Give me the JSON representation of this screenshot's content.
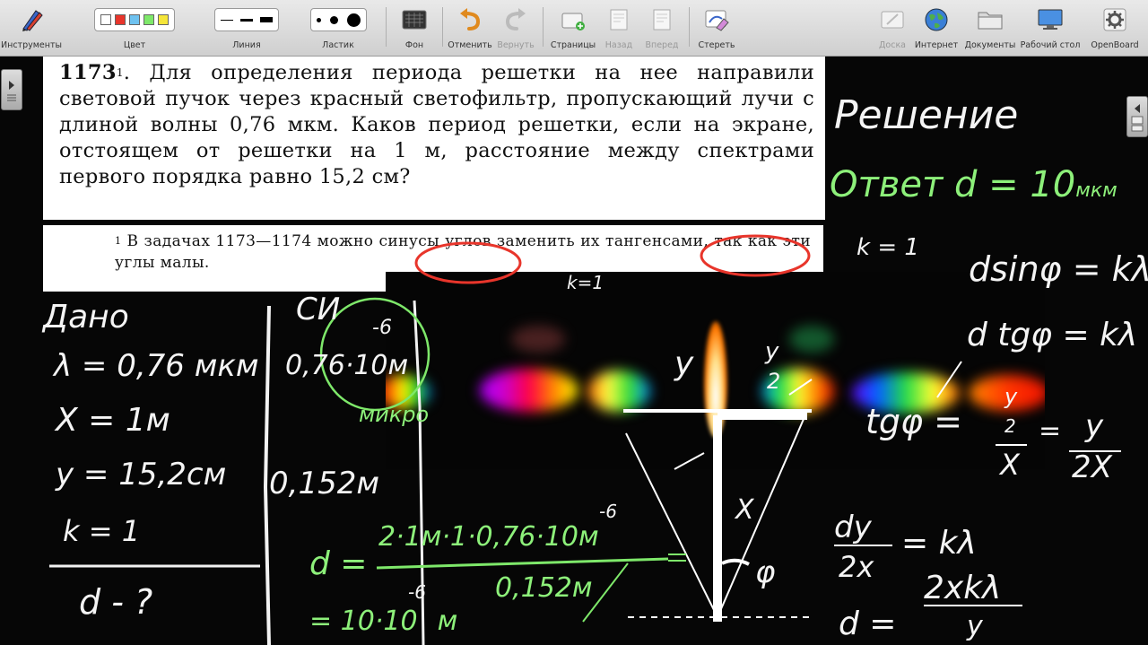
{
  "toolbar": {
    "tools_label": "Инструменты",
    "color_label": "Цвет",
    "line_label": "Линия",
    "eraser_label": "Ластик",
    "background_label": "Фон",
    "undo_label": "Отменить",
    "redo_label": "Вернуть",
    "pages_label": "Страницы",
    "back_label": "Назад",
    "forward_label": "Вперед",
    "erase_label": "Стереть",
    "board_label": "Доска",
    "internet_label": "Интернет",
    "documents_label": "Документы",
    "desktop_label": "Рабочий стол",
    "openboard_label": "OpenBoard",
    "colors": [
      "#ffffff",
      "#e8352b",
      "#6ec2f0",
      "#7ee86a",
      "#f5e63a"
    ]
  },
  "problem": {
    "number": "1173",
    "footnote_ref": "1",
    "text": ". Для определения периода решетки на нее направили световой пучок через красный светофильтр, пропускающий лучи с длиной волны 0,76 мкм. Каков период решетки, если на экране, отстоящем от решетки на 1 м, расстояние между спектрами первого порядка равно 15,2 см?"
  },
  "footnote": {
    "mark": "1",
    "text": " В задачах 1173—1174 можно синусы углов заменить их тангенсами, так как эти углы малы."
  },
  "handwriting": {
    "given_title": "Дано",
    "si_title": "СИ",
    "lambda": "λ = 0,76 мкм",
    "x": "X = 1м",
    "y": "y = 15,2см",
    "k": "k = 1",
    "find": "d - ?",
    "lambda_si": "0,76·10",
    "lambda_si_unit": "м",
    "lambda_exp": "-6",
    "y_si": "0,152м",
    "micro": "микро",
    "solution_title": "Решение",
    "answer": "Ответ d = 10",
    "answer_unit": "мкм",
    "k_right": "k = 1",
    "k_center": "k=1",
    "formula1": "dsinφ = kλ",
    "formula2": "d tgφ = kλ",
    "tg_left": "tgφ =",
    "frac_y": "y",
    "frac_2": "2",
    "frac_x": "X",
    "tg_right": "=",
    "frac_2x": "2X",
    "eq_dy": "dy",
    "eq_2x": "2x",
    "eq_kl": "= kλ",
    "eq_d": "d =",
    "eq_2xkl": "2xkλ",
    "eq_y": "y",
    "calc_d": "d =",
    "calc_num": "2·1м·1·0,76·10",
    "calc_num_unit": "м",
    "calc_num_exp": "-6",
    "calc_den": "0,152м",
    "calc_result": "= 10·10",
    "calc_result_exp": "-6",
    "calc_result_unit": "м",
    "diagram_y": "y",
    "diagram_y2_top": "y",
    "diagram_y2_bottom": "2",
    "diagram_x": "X",
    "diagram_phi": "φ"
  }
}
